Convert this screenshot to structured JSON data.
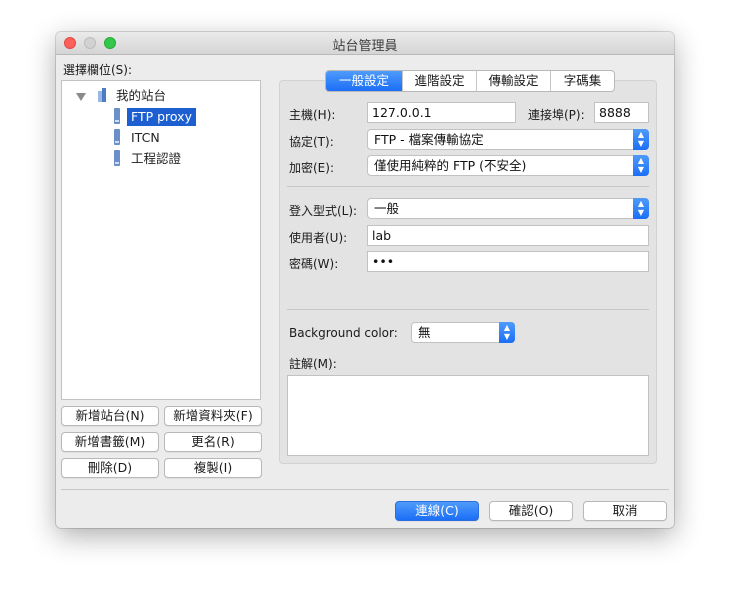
{
  "window": {
    "title": "站台管理員"
  },
  "left": {
    "label": "選擇欄位(S):",
    "tree": {
      "root": "我的站台",
      "items": [
        "FTP proxy",
        "ITCN",
        "工程認證"
      ],
      "selected_index": 0
    },
    "buttons": {
      "new_site": "新增站台(N)",
      "new_folder": "新增資料夾(F)",
      "new_bookmark": "新增書籤(M)",
      "rename": "更名(R)",
      "delete": "刪除(D)",
      "duplicate": "複製(I)"
    }
  },
  "tabs": [
    "一般設定",
    "進階設定",
    "傳輸設定",
    "字碼集"
  ],
  "active_tab": 0,
  "form": {
    "host_label": "主機(H):",
    "host_value": "127.0.0.1",
    "port_label": "連接埠(P):",
    "port_value": "8888",
    "protocol_label": "協定(T):",
    "protocol_value": "FTP - 檔案傳輸協定",
    "encryption_label": "加密(E):",
    "encryption_value": "僅使用純粹的 FTP (不安全)",
    "logon_label": "登入型式(L):",
    "logon_value": "一般",
    "user_label": "使用者(U):",
    "user_value": "lab",
    "password_label": "密碼(W):",
    "password_value": "•••",
    "bgcolor_label": "Background color:",
    "bgcolor_value": "無",
    "comments_label": "註解(M):",
    "comments_value": ""
  },
  "footer": {
    "connect": "連線(C)",
    "ok": "確認(O)",
    "cancel": "取消"
  },
  "colors": {
    "accent": "#1b6ef6",
    "selection": "#1d5fd1"
  }
}
